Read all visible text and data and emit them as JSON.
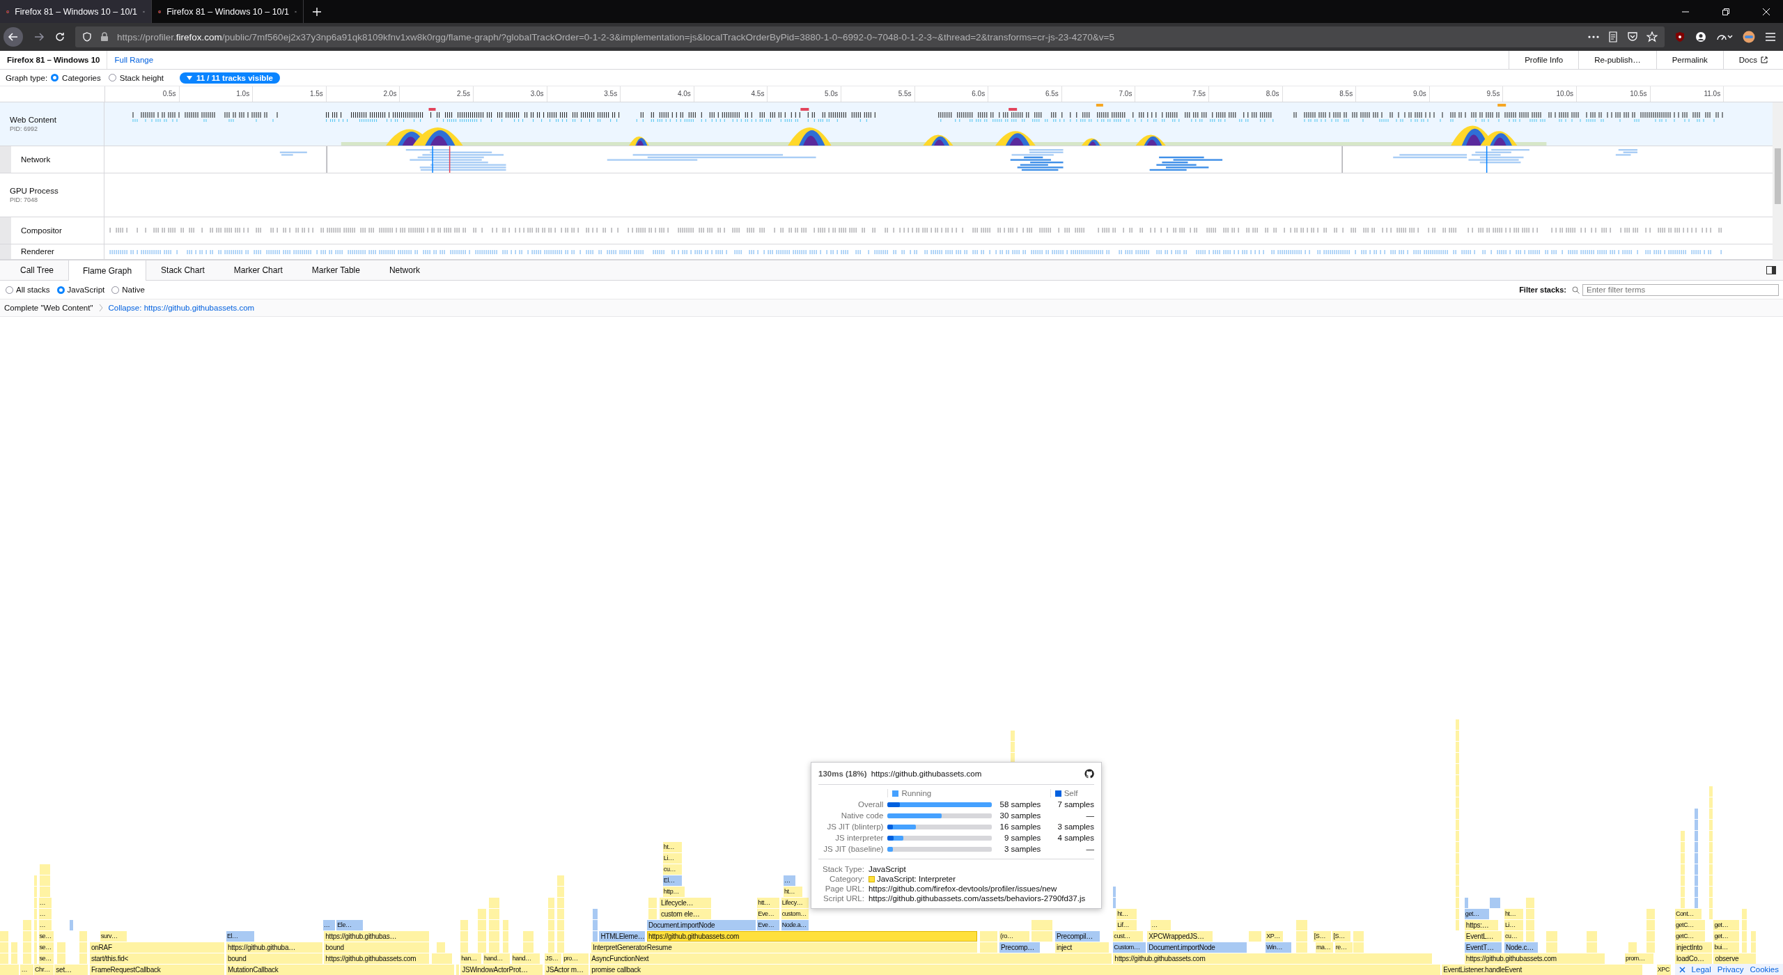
{
  "browser": {
    "tabs": [
      {
        "title": "Firefox 81 – Windows 10 – 10/1",
        "selected": true
      },
      {
        "title": "Firefox 81 – Windows 10 – 10/1",
        "selected": false
      }
    ],
    "url": {
      "before": "https://profiler.",
      "domain": "firefox.com",
      "after": "/public/7mf560ej2x37y3np6a91qk8109kfnv1xw8k0rgg/flame-graph/?globalTrackOrder=0-1-2-3&implementation=js&localTrackOrderByPid=3880-1-0~6992-0~7048-0-1-2-3~&thread=2&transforms=cr-js-23-4270&v=5"
    }
  },
  "profile_bar": {
    "title": "Firefox 81 – Windows 10",
    "range": "Full Range",
    "buttons": [
      {
        "label": "Profile Info",
        "external": false
      },
      {
        "label": "Re-publish…",
        "external": false
      },
      {
        "label": "Permalink",
        "external": false
      },
      {
        "label": "Docs",
        "external": true
      }
    ]
  },
  "graph_type": {
    "label": "Graph type:",
    "options": [
      {
        "label": "Categories",
        "selected": true
      },
      {
        "label": "Stack height",
        "selected": false
      }
    ],
    "tracks_button": "11 / 11 tracks visible"
  },
  "timeline": {
    "ticks": [
      "0.5s",
      "1.0s",
      "1.5s",
      "2.0s",
      "2.5s",
      "3.0s",
      "3.5s",
      "4.0s",
      "4.5s",
      "5.0s",
      "5.5s",
      "6.0s",
      "6.5s",
      "7.0s",
      "7.5s",
      "8.0s",
      "8.5s",
      "9.0s",
      "9.5s",
      "10.0s",
      "10.5s",
      "11.0s"
    ]
  },
  "tracks": [
    {
      "name": "Web Content",
      "pid": "PID: 6992",
      "selected": true,
      "local": false,
      "kind": "activity"
    },
    {
      "name": "Network",
      "selected": false,
      "local": true,
      "kind": "network"
    },
    {
      "name": "GPU Process",
      "pid": "PID: 7048",
      "selected": false,
      "local": false,
      "kind": "empty"
    },
    {
      "name": "Compositor",
      "selected": false,
      "local": true,
      "kind": "compositor"
    },
    {
      "name": "Renderer",
      "selected": false,
      "local": true,
      "kind": "renderer"
    }
  ],
  "panel_tabs": [
    {
      "label": "Call Tree",
      "selected": false
    },
    {
      "label": "Flame Graph",
      "selected": true
    },
    {
      "label": "Stack Chart",
      "selected": false
    },
    {
      "label": "Marker Chart",
      "selected": false
    },
    {
      "label": "Marker Table",
      "selected": false
    },
    {
      "label": "Network",
      "selected": false
    }
  ],
  "stack_options": [
    {
      "label": "All stacks",
      "selected": false
    },
    {
      "label": "JavaScript",
      "selected": true
    },
    {
      "label": "Native",
      "selected": false
    }
  ],
  "filter": {
    "label": "Filter stacks:",
    "placeholder": "Enter filter terms"
  },
  "breadcrumbs": [
    {
      "label": "Complete \"Web Content\"",
      "selected": false
    },
    {
      "label": "Collapse: https://github.githubassets.com",
      "selected": true
    }
  ],
  "flame_graph": {
    "levels": [
      {
        "frames": [
          {
            "label": "ht…",
            "color": "#fff3a3",
            "selected": false
          }
        ]
      },
      {
        "frames": [
          {
            "label": "Li…",
            "color": "#fff3a3",
            "selected": false
          }
        ]
      },
      {
        "frames": [
          {
            "label": "cu…",
            "color": "#fff3a3",
            "selected": false
          }
        ]
      },
      {
        "frames": [
          {
            "label": "El…",
            "color": "#a8c9f3",
            "selected": false
          },
          {
            "label": "…",
            "color": "#a8c9f3",
            "selected": false
          }
        ]
      },
      {
        "frames": [
          {
            "label": "http…",
            "color": "#fff3a3",
            "selected": false
          },
          {
            "label": "ht…",
            "color": "#fff3a3",
            "selected": false
          }
        ]
      },
      {
        "frames": [
          {
            "label": "…",
            "color": "#fff3a3",
            "selected": false
          },
          {
            "label": "Lifecycle…",
            "color": "#fff3a3",
            "selected": false
          },
          {
            "label": "htt…",
            "color": "#fff3a3",
            "selected": false
          },
          {
            "label": "Lifecy…",
            "color": "#fff3a3",
            "selected": false
          }
        ]
      },
      {
        "frames": [
          {
            "label": "…",
            "color": "#fff3a3",
            "selected": false
          },
          {
            "label": "custom ele…",
            "color": "#fff3a3",
            "selected": false
          },
          {
            "label": "Eve…",
            "color": "#fff3a3",
            "selected": false
          },
          {
            "label": "custom…",
            "color": "#fff3a3",
            "selected": false
          },
          {
            "label": "ht…",
            "color": "#fff3a3",
            "selected": false
          },
          {
            "label": "get…",
            "color": "#a8c9f3",
            "selected": false
          },
          {
            "label": "ht…",
            "color": "#fff3a3",
            "selected": false
          },
          {
            "label": "Cont…",
            "color": "#fff3a3",
            "selected": false
          }
        ]
      },
      {
        "frames": [
          {
            "label": "…",
            "color": "#fff3a3",
            "selected": false
          },
          {
            "label": "…",
            "color": "#a8c9f3",
            "selected": false
          },
          {
            "label": "Ele…",
            "color": "#a8c9f3",
            "selected": false
          },
          {
            "label": "Document.importNode",
            "color": "#a8c9f3",
            "selected": false
          },
          {
            "label": "Eve…",
            "color": "#a8c9f3",
            "selected": false
          },
          {
            "label": "Node.a…",
            "color": "#a8c9f3",
            "selected": false
          },
          {
            "label": "Lif…",
            "color": "#fff3a3",
            "selected": false
          },
          {
            "label": "…",
            "color": "#fff3a3",
            "selected": false
          },
          {
            "label": "https:…",
            "color": "#fff3a3",
            "selected": false
          },
          {
            "label": "Li…",
            "color": "#fff3a3",
            "selected": false
          },
          {
            "label": "getC…",
            "color": "#fff3a3",
            "selected": false
          },
          {
            "label": "get…",
            "color": "#fff3a3",
            "selected": false
          }
        ]
      },
      {
        "frames": [
          {
            "label": "se…",
            "color": "#fff3a3",
            "selected": false
          },
          {
            "label": "surv…",
            "color": "#fff3a3",
            "selected": false
          },
          {
            "label": "El…",
            "color": "#a8c9f3",
            "selected": false
          },
          {
            "label": "https://github.githubas…",
            "color": "#fff3a3",
            "selected": false
          },
          {
            "label": "HTMLEleme…",
            "color": "#a8c9f3",
            "selected": false
          },
          {
            "label": "https://github.githubassets.com",
            "color": "#ffe03c",
            "selected": true
          },
          {
            "label": "(ro…",
            "color": "#fff3a3",
            "selected": false
          },
          {
            "label": "Precompil…",
            "color": "#a8c9f3",
            "selected": false
          },
          {
            "label": "cust…",
            "color": "#fff3a3",
            "selected": false
          },
          {
            "label": "XPCWrappedJS…",
            "color": "#fff3a3",
            "selected": false
          },
          {
            "label": "XP…",
            "color": "#fff3a3",
            "selected": false
          },
          {
            "label": "[S…",
            "color": "#fff3a3",
            "selected": false
          },
          {
            "label": "[S…",
            "color": "#fff3a3",
            "selected": false
          },
          {
            "label": "EventL…",
            "color": "#fff3a3",
            "selected": false
          },
          {
            "label": "cu…",
            "color": "#fff3a3",
            "selected": false
          },
          {
            "label": "getC…",
            "color": "#fff3a3",
            "selected": false
          },
          {
            "label": "get…",
            "color": "#fff3a3",
            "selected": false
          }
        ]
      },
      {
        "frames": [
          {
            "label": "se…",
            "color": "#fff3a3",
            "selected": false
          },
          {
            "label": "onRAF",
            "color": "#fff3a3",
            "selected": false
          },
          {
            "label": "https://github.githuba…",
            "color": "#fff3a3",
            "selected": false
          },
          {
            "label": "bound",
            "color": "#fff3a3",
            "selected": false
          },
          {
            "label": "InterpretGeneratorResume",
            "color": "#fff3a3",
            "selected": false
          },
          {
            "label": "Precomp…",
            "color": "#a8c9f3",
            "selected": false
          },
          {
            "label": "inject",
            "color": "#fff3a3",
            "selected": false
          },
          {
            "label": "Custom…",
            "color": "#a8c9f3",
            "selected": false
          },
          {
            "label": "Document.importNode",
            "color": "#a8c9f3",
            "selected": false
          },
          {
            "label": "Win…",
            "color": "#a8c9f3",
            "selected": false
          },
          {
            "label": "ma…",
            "color": "#fff3a3",
            "selected": false
          },
          {
            "label": "re…",
            "color": "#fff3a3",
            "selected": false
          },
          {
            "label": "EventT…",
            "color": "#a8c9f3",
            "selected": false
          },
          {
            "label": "Node.c…",
            "color": "#a8c9f3",
            "selected": false
          },
          {
            "label": "injectInto",
            "color": "#fff3a3",
            "selected": false
          },
          {
            "label": "bui…",
            "color": "#fff3a3",
            "selected": false
          }
        ]
      },
      {
        "frames": [
          {
            "label": "se…",
            "color": "#fff3a3",
            "selected": false
          },
          {
            "label": "start/this.fid<",
            "color": "#fff3a3",
            "selected": false
          },
          {
            "label": "bound",
            "color": "#fff3a3",
            "selected": false
          },
          {
            "label": "https://github.githubassets.com",
            "color": "#fff3a3",
            "selected": false
          },
          {
            "label": "han…",
            "color": "#fff3a3",
            "selected": false
          },
          {
            "label": "hand…",
            "color": "#fff3a3",
            "selected": false
          },
          {
            "label": "hand…",
            "color": "#fff3a3",
            "selected": false
          },
          {
            "label": "JS…",
            "color": "#fff3a3",
            "selected": false
          },
          {
            "label": "pro…",
            "color": "#fff3a3",
            "selected": false
          },
          {
            "label": "AsyncFunctionNext",
            "color": "#fff3a3",
            "selected": false
          },
          {
            "label": "https://github.githubassets.com",
            "color": "#fff3a3",
            "selected": false
          },
          {
            "label": "https://github.githubassets.com",
            "color": "#fff3a3",
            "selected": false
          },
          {
            "label": "prom…",
            "color": "#fff3a3",
            "selected": false
          },
          {
            "label": "loadCo…",
            "color": "#fff3a3",
            "selected": false
          },
          {
            "label": "observe",
            "color": "#fff3a3",
            "selected": false
          }
        ]
      },
      {
        "frames": [
          {
            "label": "…",
            "color": "#fff3a3",
            "selected": false
          },
          {
            "label": "Chr…",
            "color": "#fff3a3",
            "selected": false
          },
          {
            "label": "set…",
            "color": "#fff3a3",
            "selected": false
          },
          {
            "label": "FrameRequestCallback",
            "color": "#fff3a3",
            "selected": false
          },
          {
            "label": "MutationCallback",
            "color": "#fff3a3",
            "selected": false
          },
          {
            "label": "JSWindowActorProt…",
            "color": "#fff3a3",
            "selected": false
          },
          {
            "label": "JSActor m…",
            "color": "#fff3a3",
            "selected": false
          },
          {
            "label": "promise callback",
            "color": "#fff3a3",
            "selected": false
          },
          {
            "label": "EventListener.handleEvent",
            "color": "#fff3a3",
            "selected": false
          },
          {
            "label": "XPC",
            "color": "#fff3a3",
            "selected": false
          }
        ]
      }
    ]
  },
  "tooltip": {
    "duration": "130ms (18%)",
    "title": "https://github.githubassets.com",
    "legend": [
      {
        "label": "Running",
        "color": "#45a1ff"
      },
      {
        "label": "Self",
        "color": "#0060df"
      }
    ],
    "rows": [
      {
        "label": "Overall",
        "running": {
          "text": "58 samples",
          "level": 1
        },
        "self": {
          "text": "7 samples",
          "level": 0.12
        }
      },
      {
        "label": "Native code",
        "running": {
          "text": "30 samples",
          "level": 0.52
        },
        "self": {
          "text": "—"
        }
      },
      {
        "label": "JS JIT (blinterp)",
        "running": {
          "text": "16 samples",
          "level": 0.27
        },
        "self": {
          "text": "3 samples",
          "level": 0.05
        }
      },
      {
        "label": "JS interpreter",
        "running": {
          "text": "9 samples",
          "level": 0.15
        },
        "self": {
          "text": "4 samples",
          "level": 0.06
        }
      },
      {
        "label": "JS JIT (baseline)",
        "running": {
          "text": "3 samples",
          "level": 0.05
        },
        "self": {
          "text": "—"
        }
      }
    ],
    "details": [
      {
        "label": "Stack Type:",
        "value": "JavaScript"
      },
      {
        "label": "Category:",
        "value": "JavaScript: Interpreter",
        "color": "#ffe03c"
      },
      {
        "label": "Page URL:",
        "value": "https://github.com/firefox-devtools/profiler/issues/new"
      },
      {
        "label": "Script URL:",
        "value": "https://github.githubassets.com/assets/behaviors-2790fd37.js"
      }
    ]
  },
  "footer": {
    "links": [
      "Legal",
      "Privacy",
      "Cookies"
    ]
  }
}
